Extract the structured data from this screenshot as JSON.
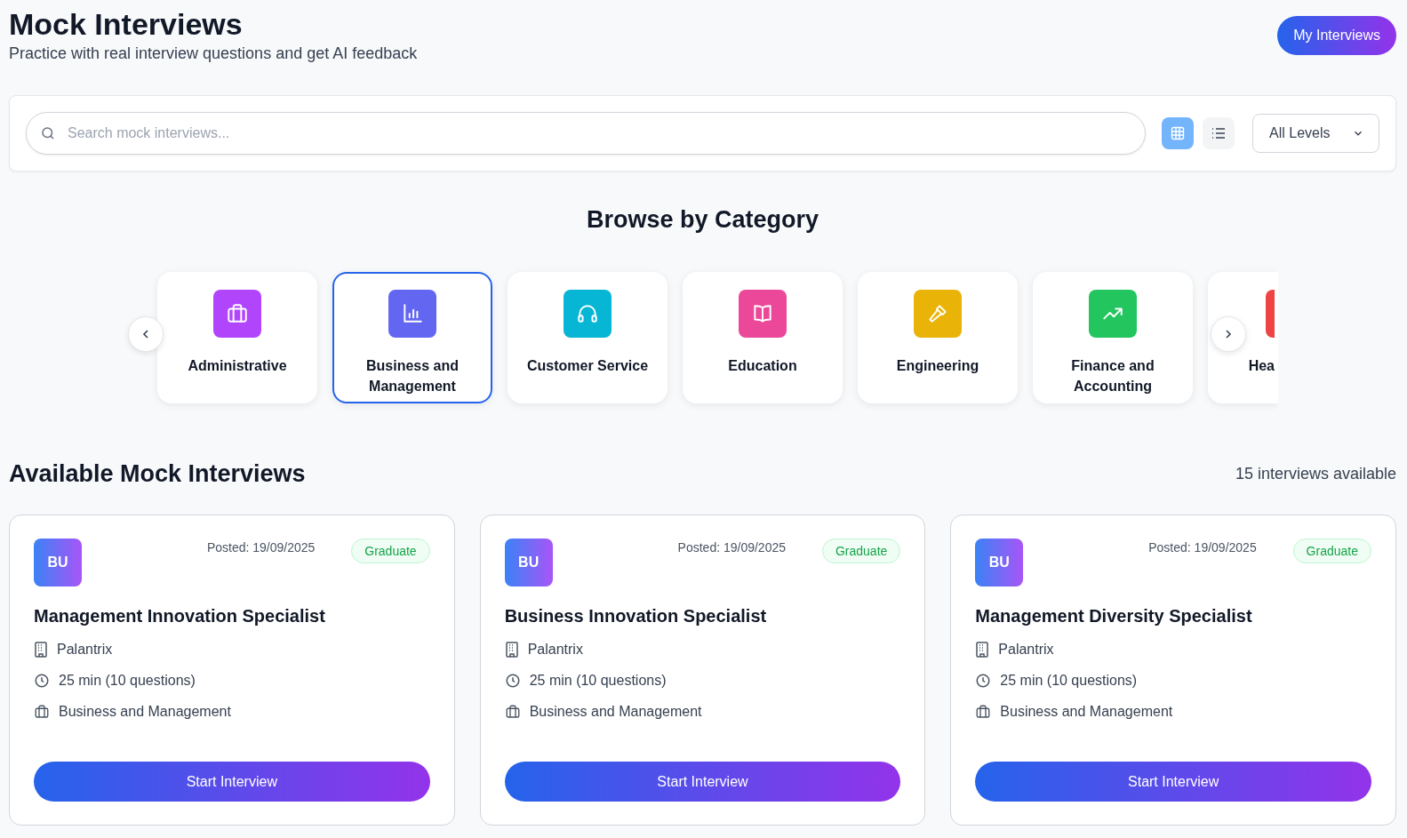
{
  "header": {
    "title": "Mock Interviews",
    "subtitle": "Practice with real interview questions and get AI feedback",
    "action": "My Interviews"
  },
  "search": {
    "placeholder": "Search mock interviews..."
  },
  "view_toggle": [
    {
      "kind": "grid",
      "selected": true
    },
    {
      "kind": "list",
      "selected": false
    }
  ],
  "level_filter": {
    "value": "All Levels"
  },
  "categories_heading": "Browse by Category",
  "categories": [
    {
      "label": "Administrative",
      "kind": "briefcase",
      "color": "#b145fb",
      "selected": false
    },
    {
      "label": "Business and Management",
      "kind": "chart",
      "color": "#6366f1",
      "selected": true
    },
    {
      "label": "Customer Service",
      "kind": "headphones",
      "color": "#06b6d4",
      "selected": false
    },
    {
      "label": "Education",
      "kind": "book",
      "color": "#ec4899",
      "selected": false
    },
    {
      "label": "Engineering",
      "kind": "hammer",
      "color": "#eab308",
      "selected": false
    },
    {
      "label": "Finance and Accounting",
      "kind": "trend",
      "color": "#22c55e",
      "selected": false
    },
    {
      "label": "Hea",
      "kind": "partial",
      "color": "#ef4444",
      "selected": false
    }
  ],
  "list_heading": "Available Mock Interviews",
  "count": "15 interviews available",
  "interviews": [
    {
      "avatar": "BU",
      "posted": "Posted: 19/09/2025",
      "level": "Graduate",
      "title": "Management Innovation Specialist",
      "company": "Palantrix",
      "duration": "25 min (10 questions)",
      "category": "Business and Management",
      "action": "Start Interview"
    },
    {
      "avatar": "BU",
      "posted": "Posted: 19/09/2025",
      "level": "Graduate",
      "title": "Business Innovation Specialist",
      "company": "Palantrix",
      "duration": "25 min (10 questions)",
      "category": "Business and Management",
      "action": "Start Interview"
    },
    {
      "avatar": "BU",
      "posted": "Posted: 19/09/2025",
      "level": "Graduate",
      "title": "Management Diversity Specialist",
      "company": "Palantrix",
      "duration": "25 min (10 questions)",
      "category": "Business and Management",
      "action": "Start Interview"
    }
  ]
}
